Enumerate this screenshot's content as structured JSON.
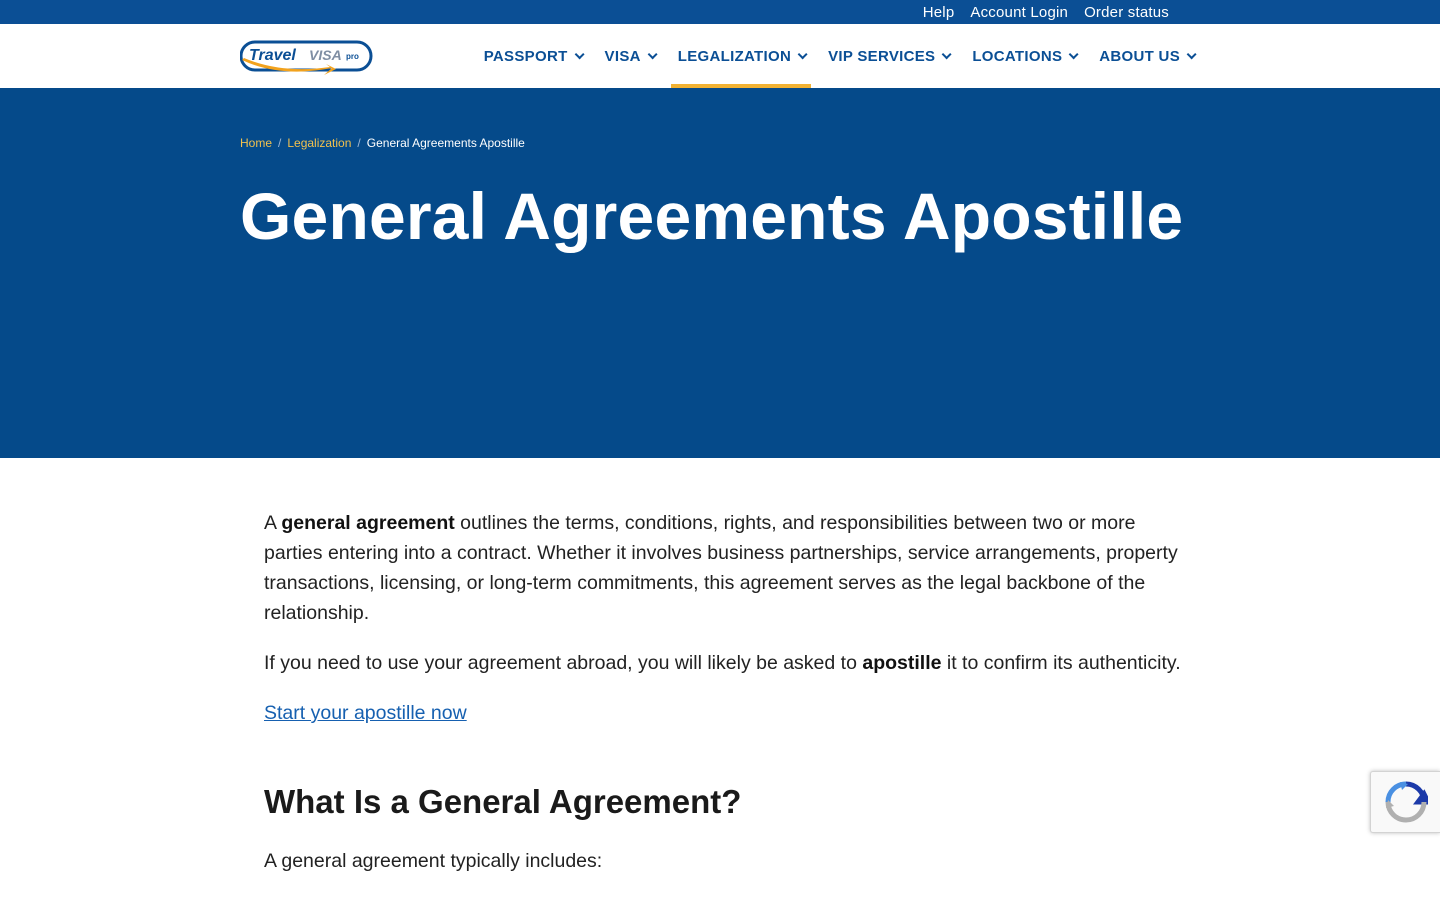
{
  "utility": {
    "links": [
      "Help",
      "Account Login",
      "Order status"
    ]
  },
  "logo": {
    "text_travel": "Travel",
    "text_visa": "VISA",
    "text_pro": "pro"
  },
  "nav": {
    "items": [
      {
        "label": "PASSPORT",
        "active": false
      },
      {
        "label": "VISA",
        "active": false
      },
      {
        "label": "LEGALIZATION",
        "active": true
      },
      {
        "label": "VIP SERVICES",
        "active": false
      },
      {
        "label": "LOCATIONS",
        "active": false
      },
      {
        "label": "ABOUT US",
        "active": false
      }
    ]
  },
  "breadcrumb": {
    "home": "Home",
    "section": "Legalization",
    "current": "General Agreements Apostille"
  },
  "hero": {
    "title": "General Agreements Apostille"
  },
  "content": {
    "p1_a": "A ",
    "p1_bold": "general agreement",
    "p1_b": " outlines the terms, conditions, rights, and responsibilities between two or more parties entering into a contract. Whether it involves business partnerships, service arrangements, property transactions, licensing, or long-term commitments, this agreement serves as the legal backbone of the relationship.",
    "p2_a": "If you need to use your agreement abroad, you will likely be asked to ",
    "p2_bold": "apostille",
    "p2_b": " it to confirm its authenticity.",
    "cta": "Start your apostille now",
    "h2": "What Is a General Agreement?",
    "p3": "A general agreement typically includes:"
  },
  "colors": {
    "brand_blue": "#054a8a",
    "utility_blue": "#0b4f95",
    "accent_gold": "#f2b233",
    "link_blue": "#1660b0"
  },
  "icons": {
    "chevron": "chevron-down-icon",
    "recaptcha": "recaptcha-icon"
  }
}
